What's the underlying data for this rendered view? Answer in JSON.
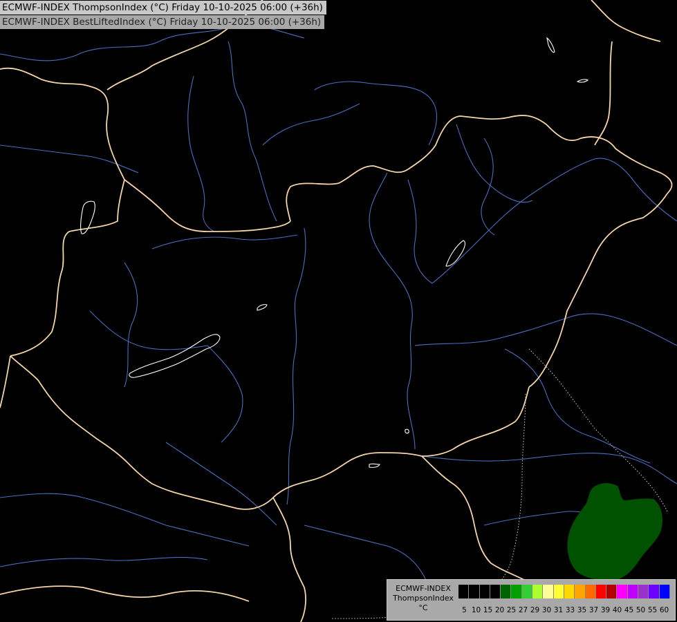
{
  "header": {
    "title_1": "ECMWF-INDEX ThompsonIndex (°C) Friday 10-10-2025 06:00 (+36h)",
    "title_2": "ECMWF-INDEX BestLiftedIndex (°C) Friday 10-10-2025 06:00 (+36h)"
  },
  "legend": {
    "line1": "ECMWF-INDEX",
    "line2": "ThompsonIndex",
    "unit": "°C",
    "colors": [
      "#000000",
      "#000000",
      "#000000",
      "#000000",
      "#006400",
      "#00a000",
      "#32cd32",
      "#adff2f",
      "#ffff99",
      "#ffff33",
      "#ffd700",
      "#ffa500",
      "#ff6a00",
      "#ff0000",
      "#b40000",
      "#ff00ff",
      "#c000ff",
      "#9932cc",
      "#6a00ff",
      "#0000ff"
    ],
    "ticks": [
      "5",
      "10",
      "15",
      "20",
      "25",
      "27",
      "29",
      "30",
      "31",
      "33",
      "35",
      "37",
      "39",
      "40",
      "45",
      "50",
      "55",
      "60"
    ]
  },
  "map": {
    "border_color": "#f5d6a8",
    "river_color": "#4a6fc0",
    "lake_color": "#ffffff",
    "blob_color": "#005200"
  }
}
